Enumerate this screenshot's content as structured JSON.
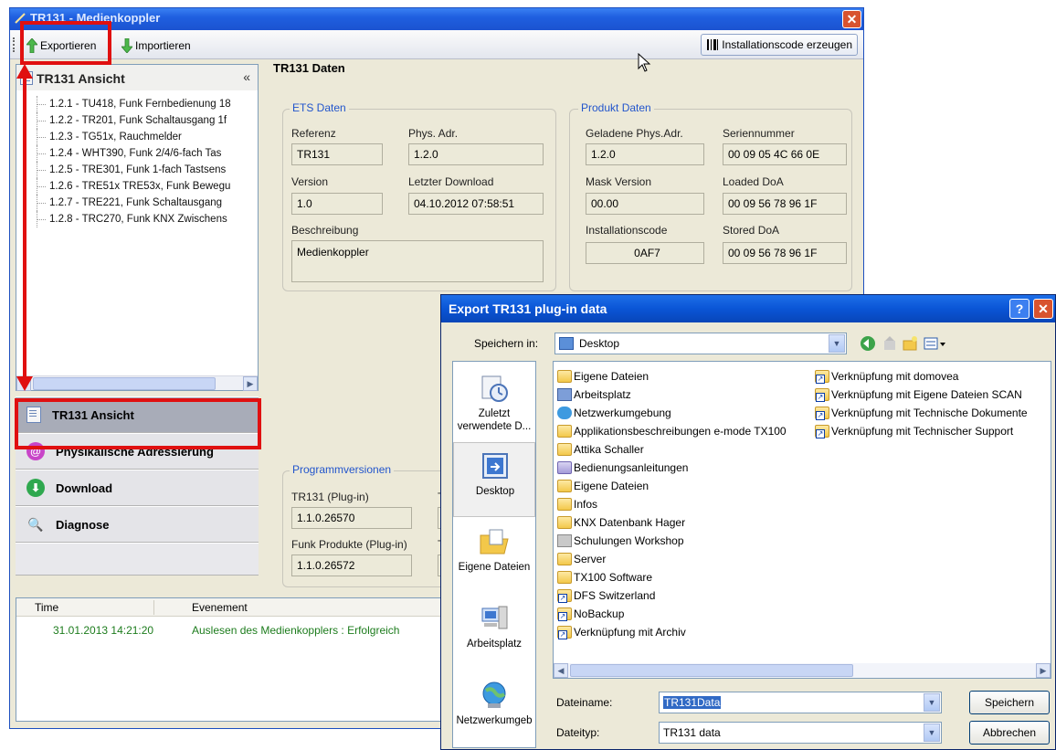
{
  "main_window": {
    "title": "TR131 - Medienkoppler",
    "toolbar": {
      "export_label": "Exportieren",
      "import_label": "Importieren",
      "install_code_label": "Installationscode erzeugen"
    },
    "left_panel": {
      "header": "TR131 Ansicht",
      "collapse_glyph": "«",
      "tree_items": [
        "1.2.1 - TU418, Funk Fernbedienung 18",
        "1.2.2 - TR201, Funk Schaltausgang 1f",
        "1.2.3 - TG51x, Rauchmelder",
        "1.2.4 - WHT390, Funk 2/4/6-fach Tas",
        "1.2.5 - TRE301, Funk 1-fach Tastsens",
        "1.2.6 - TRE51x TRE53x, Funk Bewegu",
        "1.2.7 - TRE221, Funk Schaltausgang",
        "1.2.8 - TRC270, Funk KNX Zwischens"
      ]
    },
    "nav": [
      {
        "label": "TR131 Ansicht",
        "icon": "doc-icon",
        "active": true
      },
      {
        "label": "Physikalische Adressierung",
        "icon": "at-icon",
        "active": false
      },
      {
        "label": "Download",
        "icon": "download-icon",
        "active": false
      },
      {
        "label": "Diagnose",
        "icon": "diagnose-icon",
        "active": false
      }
    ],
    "content": {
      "heading": "TR131 Daten",
      "ets": {
        "legend": "ETS Daten",
        "referenz_label": "Referenz",
        "referenz_value": "TR131",
        "phys_label": "Phys. Adr.",
        "phys_value": "1.2.0",
        "version_label": "Version",
        "version_value": "1.0",
        "download_label": "Letzter Download",
        "download_value": "04.10.2012 07:58:51",
        "beschreibung_label": "Beschreibung",
        "beschreibung_value": "Medienkoppler"
      },
      "produkt": {
        "legend": "Produkt Daten",
        "geladene_label": "Geladene Phys.Adr.",
        "geladene_value": "1.2.0",
        "serien_label": "Seriennummer",
        "serien_value": "00 09 05 4C 66 0E",
        "mask_label": "Mask Version",
        "mask_value": "00.00",
        "loaded_label": "Loaded DoA",
        "loaded_value": "00 09 56 78 96 1F",
        "install_label": "Installationscode",
        "install_value": "0AF7",
        "stored_label": "Stored DoA",
        "stored_value": "00 09 56 78 96 1F"
      },
      "programm": {
        "legend": "Programmversionen",
        "plugin_label": "TR131 (Plug-in)",
        "plugin_value": "1.1.0.26570",
        "plugin2_label": "TF",
        "plugin2_value": "1",
        "funk_label": "Funk Produkte (Plug-in)",
        "funk_value": "1.1.0.26572",
        "funk2_label": "TF",
        "funk2_value": "0"
      }
    },
    "log": {
      "col_time": "Time",
      "col_event": "Evenement",
      "rows": [
        {
          "time": "31.01.2013 14:21:20",
          "event": "Auslesen des Medienkopplers : Erfolgreich"
        }
      ]
    }
  },
  "dialog": {
    "title": "Export TR131 plug-in data",
    "help_glyph": "?",
    "close_glyph": "✕",
    "save_in_label": "Speichern in:",
    "save_in_value": "Desktop",
    "places": [
      {
        "label": "Zuletzt verwendete D...",
        "icon": "recent-icon"
      },
      {
        "label": "Desktop",
        "icon": "desktop-icon"
      },
      {
        "label": "Eigene Dateien",
        "icon": "my-documents-icon"
      },
      {
        "label": "Arbeitsplatz",
        "icon": "my-computer-icon"
      },
      {
        "label": "Netzwerkumgeb",
        "icon": "network-icon"
      }
    ],
    "files_col1": [
      {
        "name": "Eigene Dateien",
        "icon": "folder-icon"
      },
      {
        "name": "Arbeitsplatz",
        "icon": "computer-icon"
      },
      {
        "name": "Netzwerkumgebung",
        "icon": "network-icon"
      },
      {
        "name": "Applikationsbeschreibungen e-mode TX100",
        "icon": "folder-icon"
      },
      {
        "name": "Attika Schaller",
        "icon": "folder-icon"
      },
      {
        "name": "Bedienungsanleitungen",
        "icon": "folder-icon"
      },
      {
        "name": "Eigene Dateien",
        "icon": "folder-icon"
      },
      {
        "name": "Infos",
        "icon": "folder-icon"
      },
      {
        "name": "KNX Datenbank Hager",
        "icon": "folder-icon"
      },
      {
        "name": "Schulungen Workshop",
        "icon": "folder-icon"
      },
      {
        "name": "Server",
        "icon": "folder-icon"
      },
      {
        "name": "TX100 Software",
        "icon": "folder-icon"
      },
      {
        "name": "DFS Switzerland",
        "icon": "shortcut-icon"
      },
      {
        "name": "NoBackup",
        "icon": "shortcut-icon"
      },
      {
        "name": "Verknüpfung mit Archiv",
        "icon": "shortcut-icon"
      }
    ],
    "files_col2": [
      {
        "name": "Verknüpfung mit domovea",
        "icon": "shortcut-icon"
      },
      {
        "name": "Verknüpfung mit Eigene Dateien SCAN",
        "icon": "shortcut-icon"
      },
      {
        "name": "Verknüpfung mit Technische Dokumente",
        "icon": "shortcut-icon"
      },
      {
        "name": "Verknüpfung mit Technischer Support",
        "icon": "shortcut-icon"
      }
    ],
    "filename_label": "Dateiname:",
    "filename_value": "TR131Data",
    "filetype_label": "Dateityp:",
    "filetype_value": "TR131 data",
    "save_button": "Speichern",
    "cancel_button": "Abbrechen"
  },
  "colors": {
    "highlight_red": "#e01010",
    "xp_title_blue": "#1f5fe0",
    "log_green": "#1d7c1d"
  }
}
